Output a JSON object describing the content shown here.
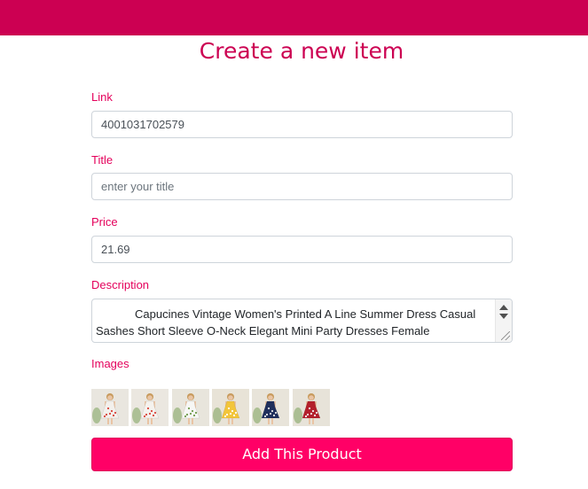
{
  "header": {
    "color": "#cc0052"
  },
  "page": {
    "title": "Create a new item"
  },
  "form": {
    "link": {
      "label": "Link",
      "value": "4001031702579"
    },
    "title": {
      "label": "Title",
      "value": "",
      "placeholder": "enter your title"
    },
    "price": {
      "label": "Price",
      "value": "21.69"
    },
    "description": {
      "label": "Description",
      "value": "Capucines Vintage Women's Printed A Line Summer Dress Casual Sashes Short Sleeve O-Neck Elegant Mini Party Dresses Female"
    },
    "images": {
      "label": "Images",
      "items": [
        {
          "dress_color": "#f3f0ec",
          "pattern_color": "#d8443a",
          "bg": "#e9e6df"
        },
        {
          "dress_color": "#f5f2ee",
          "pattern_color": "#d9463c",
          "bg": "#ebe7e0"
        },
        {
          "dress_color": "#f7f7f5",
          "pattern_color": "#6f9a4c",
          "bg": "#e8e5dc"
        },
        {
          "dress_color": "#f2c53a",
          "pattern_color": "#ffffff",
          "bg": "#e8e3d7"
        },
        {
          "dress_color": "#1f2f5c",
          "pattern_color": "#e7e7e7",
          "bg": "#e8e4da"
        },
        {
          "dress_color": "#b3202c",
          "pattern_color": "#f1f1f1",
          "bg": "#e7e3d9"
        }
      ]
    },
    "submit_label": "Add This Product"
  },
  "colors": {
    "accent": "#cc0052",
    "label": "#e4005b",
    "button": "#ff0066"
  }
}
